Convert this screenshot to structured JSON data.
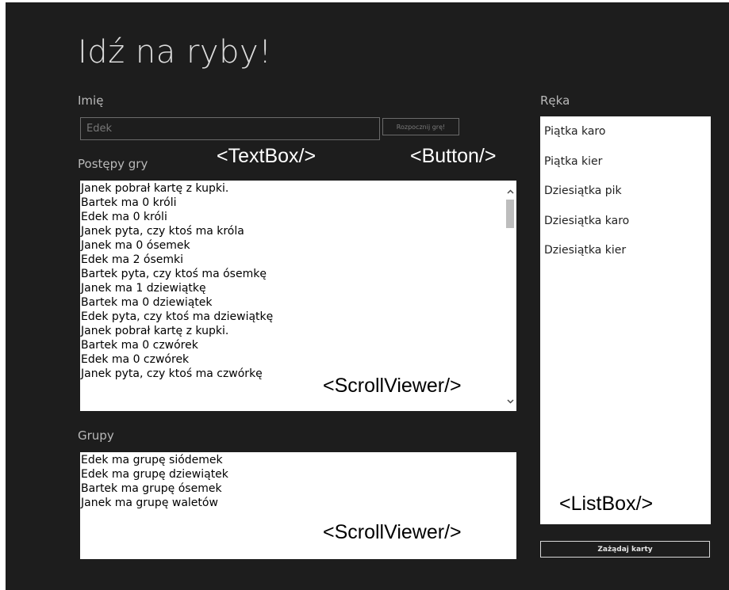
{
  "app": {
    "title": "Idź na ryby!"
  },
  "name_section": {
    "label": "Imię",
    "input_value": "",
    "input_placeholder": "Edek",
    "start_button_label": "Rozpocznij grę!"
  },
  "progress_section": {
    "label": "Postępy gry",
    "lines": [
      "Janek pobrał kartę z kupki.",
      "Bartek ma 0 króli",
      "Edek ma 0 króli",
      "Janek pyta, czy ktoś ma króla",
      "Janek ma 0 ósemek",
      "Edek ma 2 ósemki",
      "Bartek pyta, czy ktoś ma ósemkę",
      "Janek ma 1 dziewiątkę",
      "Bartek ma 0 dziewiątek",
      "Edek pyta, czy ktoś ma dziewiątkę",
      "Janek pobrał kartę z kupki.",
      "Bartek ma 0 czwórek",
      "Edek ma 0 czwórek",
      "Janek pyta, czy ktoś ma czwórkę"
    ]
  },
  "groups_section": {
    "label": "Grupy",
    "lines": [
      "Edek ma grupę siódemek",
      "Edek ma grupę dziewiątek",
      "Bartek ma grupę ósemek",
      "Janek ma grupę waletów"
    ]
  },
  "hand_section": {
    "label": "Ręka",
    "items": [
      "Piątka karo",
      "Piątka kier",
      "Dziesiątka pik",
      "Dziesiątka karo",
      "Dziesiątka kier"
    ],
    "request_button_label": "Zażądaj karty"
  },
  "annotations": {
    "textbox": "<TextBox/>",
    "button": "<Button/>",
    "scrollviewer_progress": "<ScrollViewer/>",
    "scrollviewer_groups": "<ScrollViewer/>",
    "listbox": "<ListBox/>"
  },
  "icons": {
    "scroll_up": "chevron-up-icon",
    "scroll_down": "chevron-down-icon"
  },
  "colors": {
    "app_background": "#1d1d1d",
    "panel_background": "#ffffff",
    "label_text": "#b9b9b9"
  }
}
